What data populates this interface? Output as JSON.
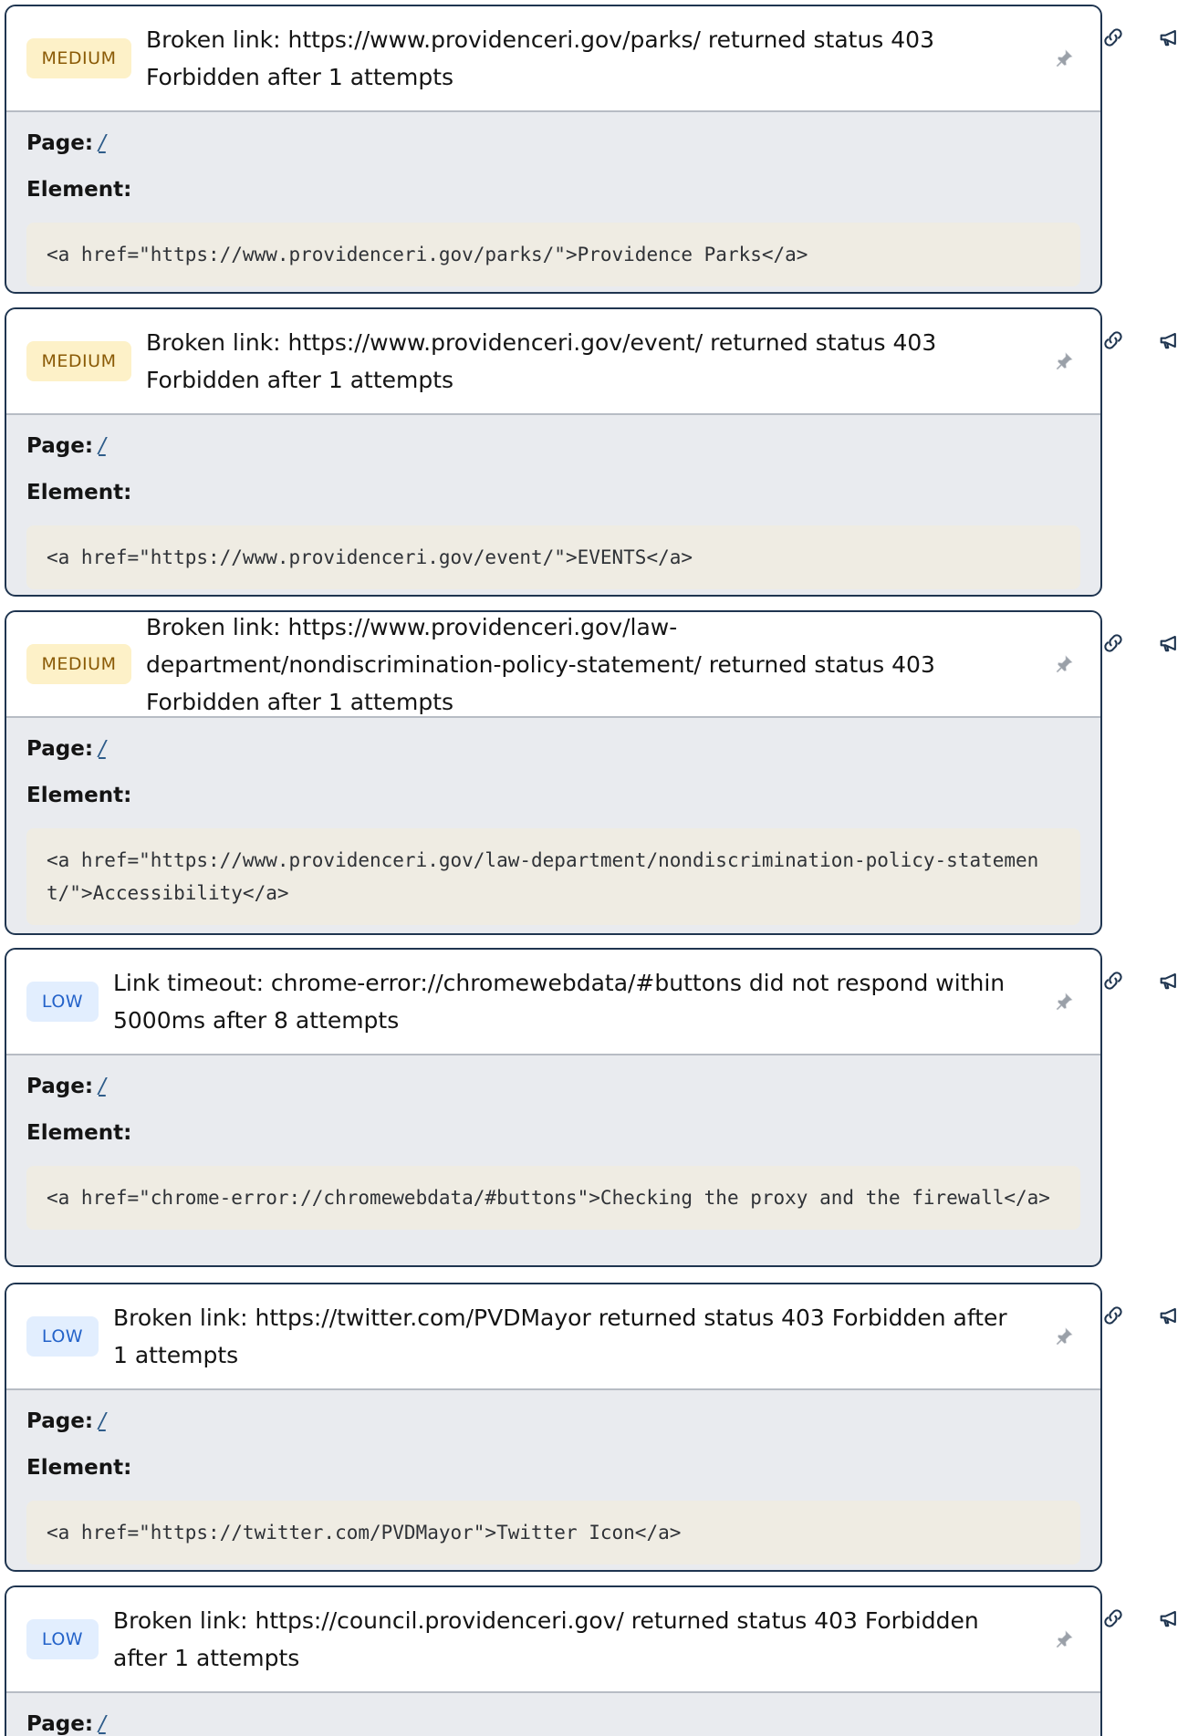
{
  "labels": {
    "page": "Page:",
    "element": "Element:"
  },
  "colors": {
    "card_border": "#1f3550",
    "medium_badge_bg": "#fdf1c8",
    "medium_badge_text": "#8a5a06",
    "low_badge_bg": "#e2eefe",
    "low_badge_text": "#2362c9",
    "code_bg": "#efece3",
    "body_bg": "#e9ebef"
  },
  "icons": {
    "header": "pin-icon",
    "copy_link": "link-icon",
    "report": "megaphone-icon"
  },
  "issues": [
    {
      "severity": "MEDIUM",
      "title": "Broken link: https://www.providenceri.gov/parks/ returned status 403 Forbidden after 1 attempts",
      "page": "/",
      "element": "<a href=\"https://www.providenceri.gov/parks/\">Providence Parks</a>"
    },
    {
      "severity": "MEDIUM",
      "title": "Broken link: https://www.providenceri.gov/event/ returned status 403 Forbidden after 1 attempts",
      "page": "/",
      "element": "<a href=\"https://www.providenceri.gov/event/\">EVENTS</a>"
    },
    {
      "severity": "MEDIUM",
      "title": "Broken link: https://www.providenceri.gov/law-department/nondiscrimination-policy-statement/ returned status 403 Forbidden after 1 attempts",
      "page": "/",
      "element": "<a href=\"https://www.providenceri.gov/law-department/nondiscrimination-policy-statement/\">Accessibility</a>"
    },
    {
      "severity": "LOW",
      "title": "Link timeout: chrome-error://chromewebdata/#buttons did not respond within 5000ms after 8 attempts",
      "page": "/",
      "element": "<a href=\"chrome-error://chromewebdata/#buttons\">Checking the proxy and the firewall</a>"
    },
    {
      "severity": "LOW",
      "title": "Broken link: https://twitter.com/PVDMayor returned status 403 Forbidden after 1 attempts",
      "page": "/",
      "element": "<a href=\"https://twitter.com/PVDMayor\">Twitter Icon</a>"
    },
    {
      "severity": "LOW",
      "title": "Broken link: https://council.providenceri.gov/ returned status 403 Forbidden after 1 attempts",
      "page": "/",
      "element": ""
    }
  ]
}
